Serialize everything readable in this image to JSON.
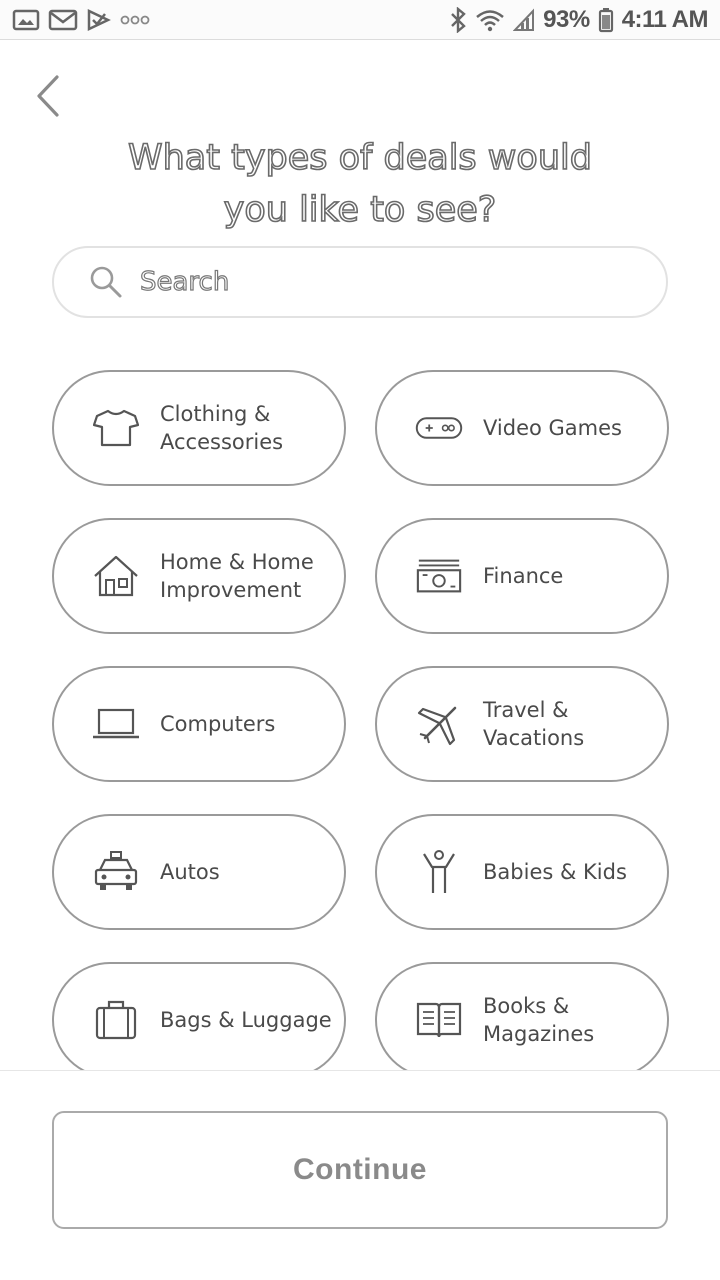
{
  "status_bar": {
    "battery": "93%",
    "time": "4:11 AM",
    "left_icons": [
      "gallery-icon",
      "gmail-icon",
      "check-icon",
      "more-dots-icon"
    ],
    "right_icons": [
      "bluetooth-icon",
      "wifi-icon",
      "signal-icon",
      "battery-icon"
    ]
  },
  "header": {
    "back_icon": "chevron-left-icon",
    "title_line1": "What types of deals would",
    "title_line2": "you like to see?"
  },
  "search": {
    "placeholder": "Search",
    "icon": "search-icon"
  },
  "categories": [
    {
      "label": "Clothing &\nAccessories",
      "icon": "tshirt-icon"
    },
    {
      "label": "Video Games",
      "icon": "gamepad-icon"
    },
    {
      "label": "Home & Home\nImprovement",
      "icon": "house-icon"
    },
    {
      "label": "Finance",
      "icon": "money-icon"
    },
    {
      "label": "Computers",
      "icon": "laptop-icon"
    },
    {
      "label": "Travel &\nVacations",
      "icon": "airplane-icon"
    },
    {
      "label": "Autos",
      "icon": "car-icon"
    },
    {
      "label": "Babies & Kids",
      "icon": "child-icon"
    },
    {
      "label": "Bags & Luggage",
      "icon": "luggage-icon"
    },
    {
      "label": "Books &\nMagazines",
      "icon": "book-icon"
    }
  ],
  "footer": {
    "continue_label": "Continue"
  }
}
